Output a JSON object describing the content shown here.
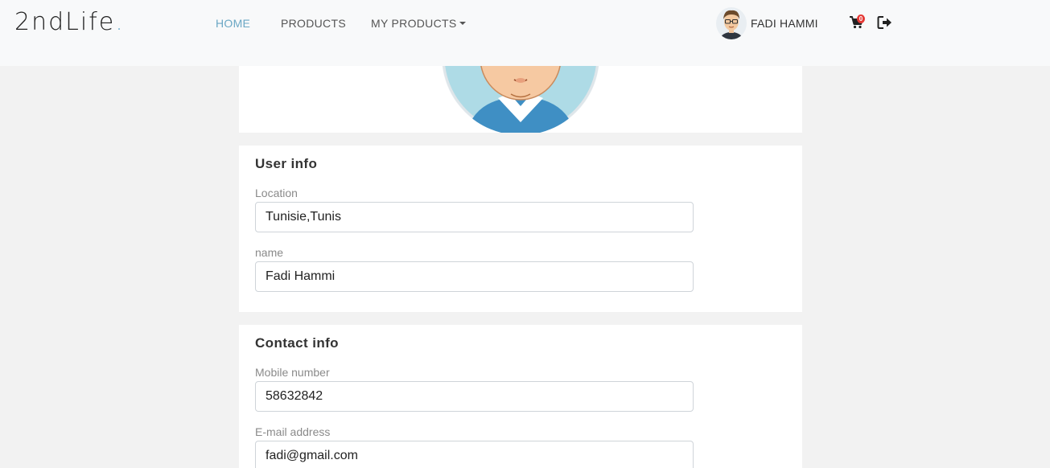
{
  "brand": {
    "name": "2ndLife",
    "dot": "."
  },
  "nav": {
    "home": "HOME",
    "products": "PRODUCTS",
    "my_products": "MY PRODUCTS"
  },
  "user": {
    "name": "FADI HAMMI"
  },
  "cart": {
    "count": "0"
  },
  "user_info": {
    "title": "User info",
    "location_label": "Location",
    "location_value": "Tunisie,Tunis",
    "name_label": "name",
    "name_value": "Fadi Hammi"
  },
  "contact_info": {
    "title": "Contact info",
    "mobile_label": "Mobile number",
    "mobile_value": "58632842",
    "email_label": "E-mail address",
    "email_value": "fadi@gmail.com"
  },
  "colors": {
    "accent": "#6aa7c4",
    "badge": "#e53935"
  },
  "icons": [
    "user-avatar",
    "cart-icon",
    "logout-icon",
    "profile-avatar"
  ]
}
